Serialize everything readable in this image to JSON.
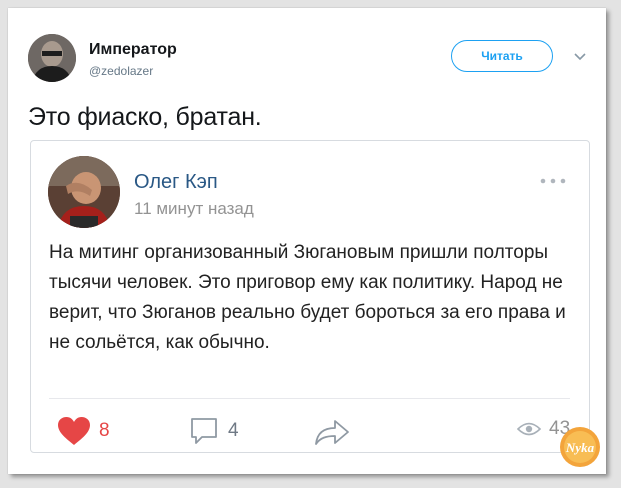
{
  "tweet": {
    "author_name": "Император",
    "author_handle": "@zedolazer",
    "follow_label": "Читать",
    "text": "Это фиаско, братан."
  },
  "embedded_post": {
    "author_name": "Олег Кэп",
    "time_ago": "11 минут назад",
    "body": "На митинг организованный Зюгановым пришли полторы тысячи человек. Это приговор ему как политику. Народ не верит, что Зюганов реально будет бороться за его права и не сольётся, как обычно.",
    "likes": "8",
    "comments": "4",
    "views": "43"
  },
  "watermark": {
    "text": "Nyka"
  },
  "colors": {
    "accent_blue": "#1da1f2",
    "vk_name": "#2a5885",
    "like_red": "#e64646"
  }
}
